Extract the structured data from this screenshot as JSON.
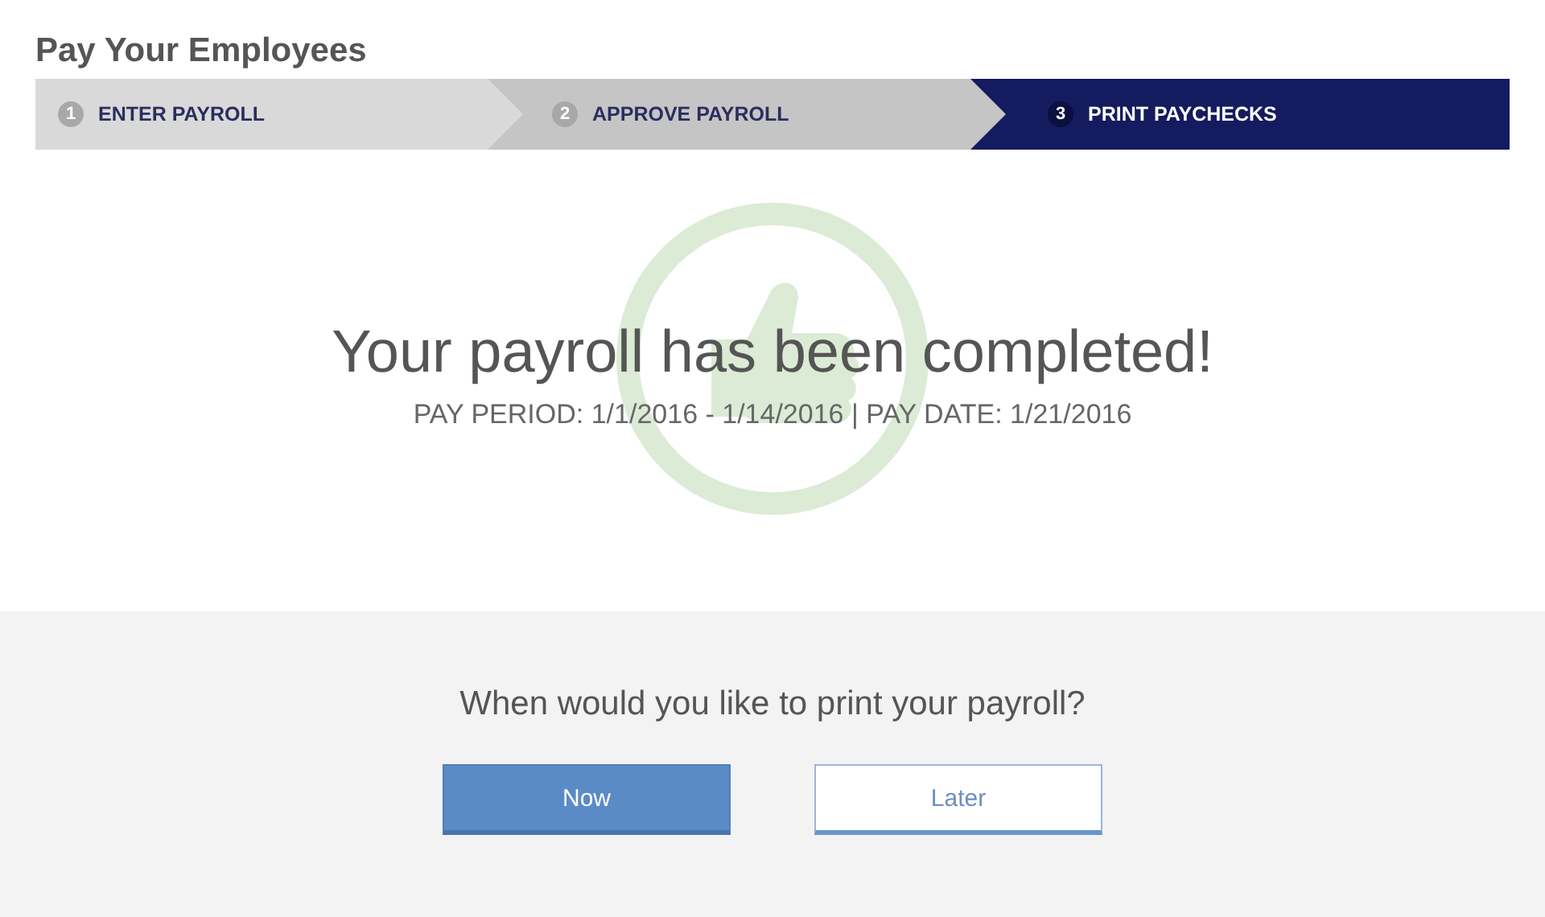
{
  "page_title": "Pay Your Employees",
  "steps": [
    {
      "number": "1",
      "label": "ENTER PAYROLL",
      "selected": false
    },
    {
      "number": "2",
      "label": "APPROVE PAYROLL",
      "selected": false
    },
    {
      "number": "3",
      "label": "PRINT PAYCHECKS",
      "selected": true
    }
  ],
  "confirmation": {
    "heading": "Your payroll has been completed!",
    "details": "PAY PERIOD: 1/1/2016 - 1/14/2016 | PAY DATE: 1/21/2016"
  },
  "print_prompt": {
    "question": "When would you like to print your payroll?",
    "buttons": [
      {
        "label": "Now",
        "kind": "primary"
      },
      {
        "label": "Later",
        "kind": "secondary"
      }
    ]
  }
}
